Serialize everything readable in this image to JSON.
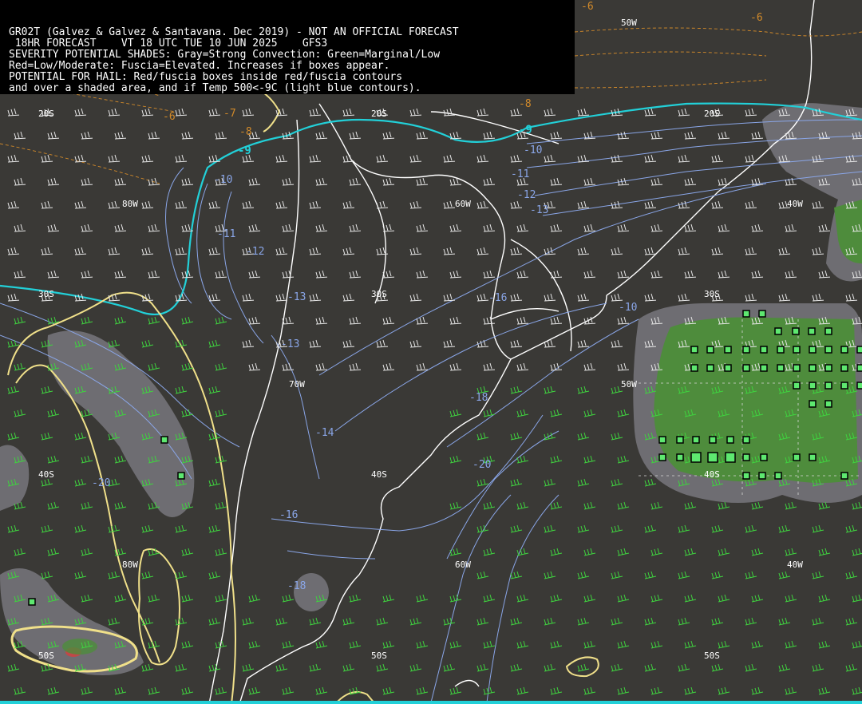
{
  "header": {
    "line1": "GR02T (Galvez & Galvez & Santavana. Dec 2019) - NOT AN OFFICIAL FORECAST",
    "line2": " 18HR FORECAST    VT 18 UTC TUE 10 JUN 2025    GFS3",
    "line3": "SEVERITY POTENTIAL SHADES: Gray=Strong Convection: Green=Marginal/Low",
    "line4": "Red=Low/Moderate: Fuscia=Elevated. Increases if boxes appear.",
    "line5": "POTENTIAL FOR HAIL: Red/fuscia boxes inside red/fuscia contours",
    "line6": "and over a shaded area, and if Temp 500<-9C (light blue contours)."
  },
  "grid_labels": {
    "lat20": "20S",
    "lat30": "30S",
    "lat40": "40S",
    "lat50": "50S",
    "lon80": "80W",
    "lon70": "70W",
    "lon60": "60W",
    "lon50": "50W",
    "lon40": "40W"
  },
  "temp_labels": {
    "m6": "-6",
    "m7": "-7",
    "m8": "-8",
    "m9": "-9",
    "m10": "-10",
    "m11": "-11",
    "m12": "-12",
    "m13": "-13",
    "m14": "-14",
    "m16": "-16",
    "m18": "-18",
    "m20": "-20"
  },
  "colors": {
    "background": "#3a3936",
    "coastline": "#ffffff",
    "temp_contour": "#8aa6e8",
    "minus9_contour": "#22d0d8",
    "hail_contour": "#f0e08a",
    "temp_dash": "#d28a2a",
    "gray_shade": "#6e6d72",
    "green_shade": "#4e8c3c",
    "barb_white": "#e8e8e8",
    "barb_green": "#3fd23f",
    "box": "#5ee870"
  }
}
